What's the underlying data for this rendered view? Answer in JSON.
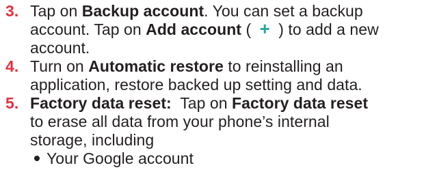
{
  "steps": [
    {
      "number": "3.",
      "line1_a": "Tap on ",
      "line1_b": "Backup account",
      "line1_c": ". You can set a backup",
      "line2_a": "account. Tap on ",
      "line2_b": "Add account",
      "line2_c": " ( ",
      "line2_icon": "+",
      "line2_d": " ) to add a new",
      "line3": "account."
    },
    {
      "number": "4.",
      "line1_a": "Turn on ",
      "line1_b": "Automatic restore",
      "line1_c": " to reinstalling an",
      "line2": "application, restore backed up setting and data."
    },
    {
      "number": "5.",
      "line1_b1": "Factory data reset:",
      "line1_a": "  Tap on ",
      "line1_b2": "Factory data reset",
      "line2": "to erase all data from your phone’s internal",
      "line3": "storage, including",
      "bullet": "Your Google account"
    }
  ],
  "colors": {
    "step_number": "#e4313f",
    "plus_icon": "#27a7a0",
    "text": "#231f20"
  },
  "icons": {
    "add_icon": "plus-icon"
  }
}
